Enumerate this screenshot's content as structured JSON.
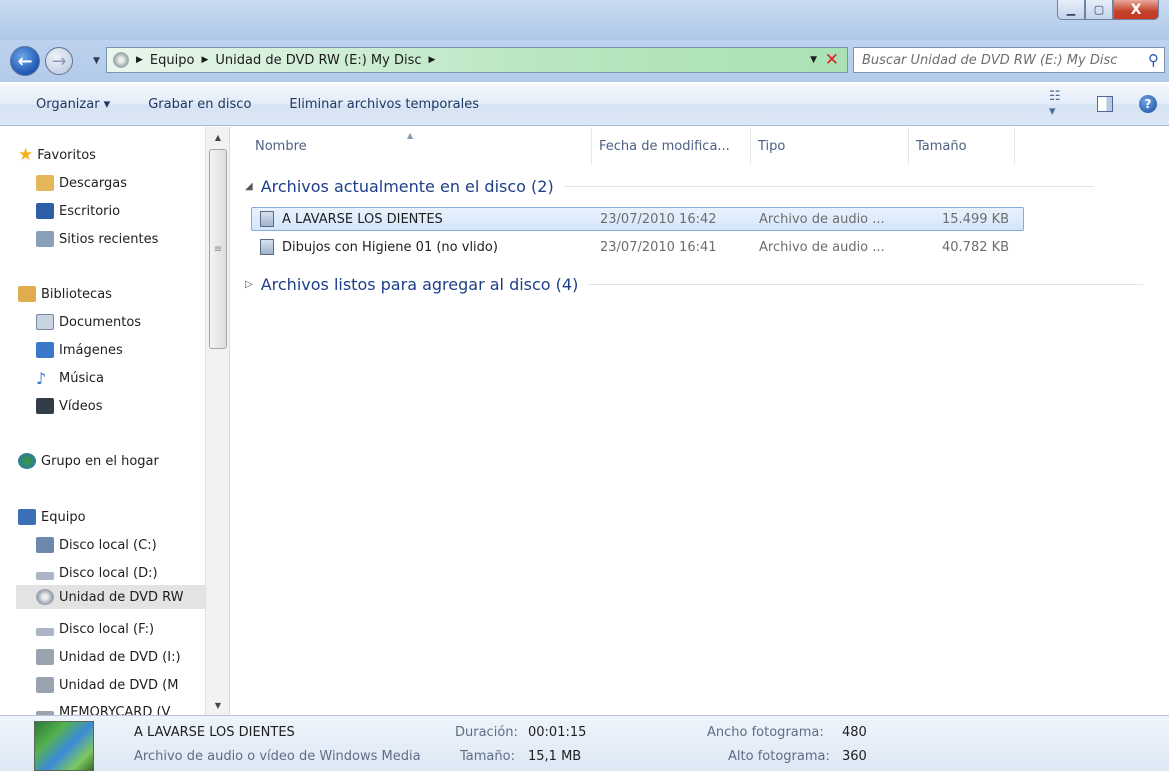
{
  "window": {
    "controls": {
      "minimize": "▁",
      "maximize": "▢",
      "close": "X"
    }
  },
  "address": {
    "crumbs": [
      "Equipo",
      "Unidad de DVD RW (E:) My Disc"
    ],
    "search_placeholder": "Buscar Unidad de DVD RW (E:) My Disc"
  },
  "toolbar": {
    "organize": "Organizar ▾",
    "burn": "Grabar en disco",
    "delete_temp": "Eliminar archivos temporales"
  },
  "sidebar": {
    "items": [
      {
        "label": "Favoritos",
        "icon": "star-icon",
        "color": "#f2b21b"
      },
      {
        "label": "Descargas",
        "icon": "downloads-folder-icon",
        "color": "#e6b65b"
      },
      {
        "label": "Escritorio",
        "icon": "desktop-icon",
        "color": "#2d5fa8"
      },
      {
        "label": "Sitios recientes",
        "icon": "recent-places-icon",
        "color": "#8aa0b8"
      },
      {
        "label": "Bibliotecas",
        "icon": "libraries-icon",
        "color": "#e0ad4e"
      },
      {
        "label": "Documentos",
        "icon": "documents-icon",
        "color": "#c9d4e2"
      },
      {
        "label": "Imágenes",
        "icon": "pictures-icon",
        "color": "#3a79c7"
      },
      {
        "label": "Música",
        "icon": "music-icon",
        "color": "#2a7ad8"
      },
      {
        "label": "Vídeos",
        "icon": "videos-icon",
        "color": "#333d4a"
      },
      {
        "label": "Grupo en el hogar",
        "icon": "homegroup-icon",
        "color": "#3b9a3b"
      },
      {
        "label": "Equipo",
        "icon": "computer-icon",
        "color": "#3b6fb8"
      },
      {
        "label": "Disco local (C:)",
        "icon": "system-drive-icon",
        "color": "#6c88ad"
      },
      {
        "label": "Disco local (D:)",
        "icon": "drive-icon",
        "color": "#aab4c2"
      },
      {
        "label": "Unidad de DVD RW",
        "icon": "dvd-drive-icon",
        "color": "#9aa4b0"
      },
      {
        "label": "Disco local (F:)",
        "icon": "drive-icon",
        "color": "#aab4c2"
      },
      {
        "label": "Unidad de DVD (I:)",
        "icon": "dvd-drive-icon",
        "color": "#9aa4b0"
      },
      {
        "label": "Unidad de DVD (M",
        "icon": "dvd-drive-icon",
        "color": "#9aa4b0"
      },
      {
        "label": "MEMORYCARD (V",
        "icon": "memory-card-icon",
        "color": "#9aa4b0"
      }
    ]
  },
  "columns": {
    "name": "Nombre",
    "date": "Fecha de modifica...",
    "type": "Tipo",
    "size": "Tamaño"
  },
  "groups": {
    "on_disc": "Archivos actualmente en el disco (2)",
    "ready": "Archivos listos para agregar al disco (4)"
  },
  "files": [
    {
      "name": "A LAVARSE LOS DIENTES",
      "date": "23/07/2010 16:42",
      "type": "Archivo de audio ...",
      "size": "15.499 KB"
    },
    {
      "name": "Dibujos con Higiene 01 (no vlido)",
      "date": "23/07/2010 16:41",
      "type": "Archivo de audio ...",
      "size": "40.782 KB"
    }
  ],
  "details": {
    "name": "A LAVARSE LOS DIENTES",
    "type": "Archivo de audio o vídeo de Windows Media",
    "duration_label": "Duración:",
    "duration": "00:01:15",
    "size_label": "Tamaño:",
    "size": "15,1 MB",
    "width_label": "Ancho fotograma:",
    "width": "480",
    "height_label": "Alto fotograma:",
    "height": "360"
  }
}
